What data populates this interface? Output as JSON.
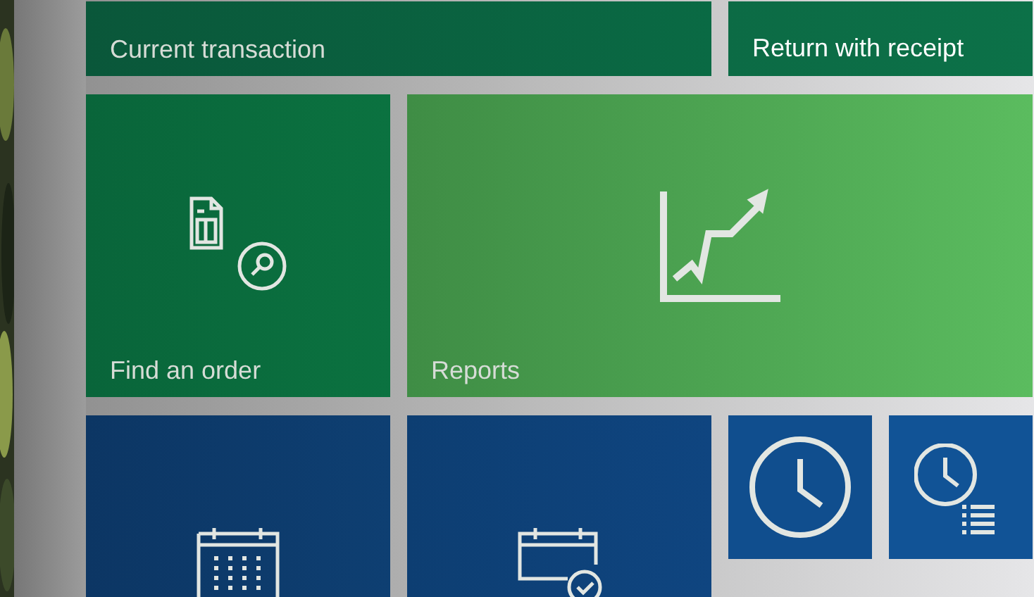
{
  "tiles": [
    {
      "kind": "banner-dark",
      "label": "Current transaction"
    },
    {
      "kind": "banner",
      "label": "Return with receipt"
    },
    {
      "kind": "find-order",
      "label": "Find an order"
    },
    {
      "kind": "reports",
      "label": "Reports"
    },
    {
      "kind": "calendar"
    },
    {
      "kind": "calendar-check"
    },
    {
      "kind": "clock"
    },
    {
      "kind": "clock-list"
    }
  ]
}
